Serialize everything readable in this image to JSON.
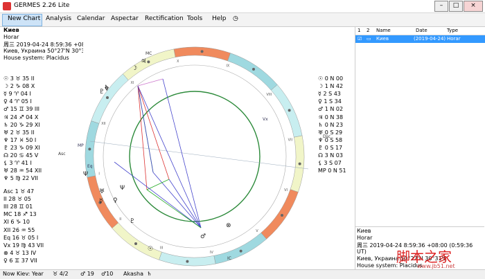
{
  "window": {
    "title": "GERMES 2.26 Lite",
    "min": "–",
    "max": "□",
    "close": "×"
  },
  "menu": [
    "New Chart",
    "Analysis",
    "Calendar",
    "Aspectar",
    "Rectification",
    "Tools",
    "Help"
  ],
  "header_lines": [
    "Киев",
    "Horar",
    "周三 2019-04-24 8:59:36 +08:00 (0:59:36 UT)",
    "Киев, Украина 50°27'N 30°31'E",
    "House system: Placidus"
  ],
  "planets_left": [
    {
      "g": "☉",
      "t": "3 ♉ 35 II"
    },
    {
      "g": "☽",
      "t": "2 ♑ 08 X"
    },
    {
      "g": "☿",
      "t": "9 ♈ 04 I"
    },
    {
      "g": "♀",
      "t": "4 ♈ 05 I"
    },
    {
      "g": "♂",
      "t": "15 ♊ 39 III"
    },
    {
      "g": "♃",
      "t": "24 ♐ 04 X"
    },
    {
      "g": "♄",
      "t": "20 ♑ 29 XI"
    },
    {
      "g": "♅",
      "t": "2 ♉ 35 II"
    },
    {
      "g": "♆",
      "t": "17 ♓ 50 I"
    },
    {
      "g": "♇",
      "t": "23 ♑ 09 XI"
    },
    {
      "g": "☊",
      "t": "20 ♋ 45 V"
    },
    {
      "g": "⚸",
      "t": "3 ♈ 41 I"
    },
    {
      "g": "♅",
      "t": "28 ♒ 54 XII"
    },
    {
      "g": "♆",
      "t": "5 ♍ 22 VII"
    }
  ],
  "houses_left": [
    {
      "g": "Asc",
      "t": "1 ♉ 47"
    },
    {
      "g": "II",
      "t": "28 ♉ 05"
    },
    {
      "g": "III",
      "t": "28 ♊ 01"
    },
    {
      "g": "MC",
      "t": "18 ♐ 13"
    },
    {
      "g": "XI",
      "t": "6 ♑ 10"
    },
    {
      "g": "XII",
      "t": "26 ♒ 55"
    },
    {
      "g": "Eq",
      "t": "16 ♉ 05 I"
    },
    {
      "g": "Vx",
      "t": "19 ♍ 43 VII"
    },
    {
      "g": "⊗",
      "t": "4 ♉ 13 IV"
    },
    {
      "g": "♀",
      "t": "6 ♊ 37 VII"
    }
  ],
  "positions_right": [
    {
      "g": "☉",
      "t": "0 N 00"
    },
    {
      "g": "☽",
      "t": "1 N 42"
    },
    {
      "g": "☿",
      "t": "2 S 43"
    },
    {
      "g": "♀",
      "t": "1 S 34"
    },
    {
      "g": "♂",
      "t": "1 N 02"
    },
    {
      "g": "♃",
      "t": "0 N 38"
    },
    {
      "g": "♄",
      "t": "0 N 23"
    },
    {
      "g": "♅",
      "t": "0 S 29"
    },
    {
      "g": "♆",
      "t": "0 S 58"
    },
    {
      "g": "♇",
      "t": "0 S 17"
    },
    {
      "g": "☊",
      "t": "3 N 03"
    },
    {
      "g": "⚸",
      "t": "3 S 07"
    },
    {
      "g": "MP",
      "t": "0 N 51"
    }
  ],
  "list": {
    "headers": [
      "1",
      "2",
      "Name",
      "Date",
      "Type"
    ],
    "row": {
      "name": "Киев",
      "date": "(2019-04-24)",
      "type": "Horar"
    }
  },
  "info": [
    "Киев",
    "Horar",
    "周三 2019-04-24 8:59:36 +08:00 (0:59:36",
    "UT)",
    "Киев, Украина 50°27'N 30°31'E",
    "House system: Placidus"
  ],
  "status": [
    "Now Kiev: Year",
    "♉ 4/2",
    "♂ 19",
    "♂10",
    "Akasha",
    "♄"
  ],
  "watermark": {
    "main": "脚本之家",
    "sub": "www.jb51.net"
  },
  "chart_labels": {
    "mc": "MC",
    "asc": "Asc",
    "dsc": "Dsc",
    "ic": "IC",
    "mp": "MP",
    "eq": "Eq",
    "vx": "Vx"
  },
  "house_numerals": [
    "I",
    "II",
    "III",
    "IV",
    "V",
    "VI",
    "VII",
    "VIII",
    "IX",
    "X",
    "XI",
    "XII"
  ],
  "colors": {
    "fire": "#f08a5d",
    "earth": "#f1f5c8",
    "air": "#c8eef0",
    "water": "#9fd9e0",
    "ring": "#2c8a3a",
    "accent": "#3399ff"
  }
}
